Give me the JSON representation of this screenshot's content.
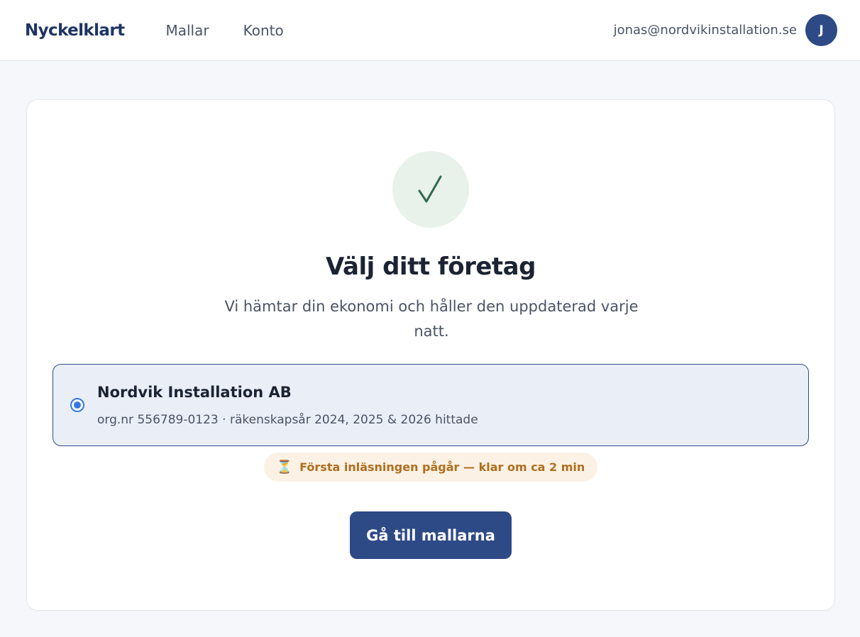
{
  "header": {
    "brand": "Nyckelklart",
    "nav": [
      {
        "label": "Mallar"
      },
      {
        "label": "Konto"
      }
    ],
    "user_email": "jonas@nordvikinstallation.se",
    "avatar_initial": "J"
  },
  "main": {
    "success_icon": "checkmark-icon",
    "title": "Välj ditt företag",
    "subtitle": "Vi hämtar din ekonomi och håller den uppdaterad varje natt.",
    "company": {
      "name": "Nordvik Installation AB",
      "meta": "org.nr 556789-0123 · räkenskapsår 2024, 2025 & 2026 hittade",
      "selected": true
    },
    "status": {
      "icon": "hourglass-icon",
      "text": "Första inläsningen pågår — klar om ca 2 min"
    },
    "cta_label": "Gå till mallarna"
  },
  "colors": {
    "brand": "#1f3563",
    "primary": "#2e4a86",
    "radio": "#3478e8",
    "success_bg": "#e8f1ea",
    "success_check": "#2f6b4c",
    "status_bg": "#fbf1e4",
    "status_text": "#b06e1e"
  }
}
